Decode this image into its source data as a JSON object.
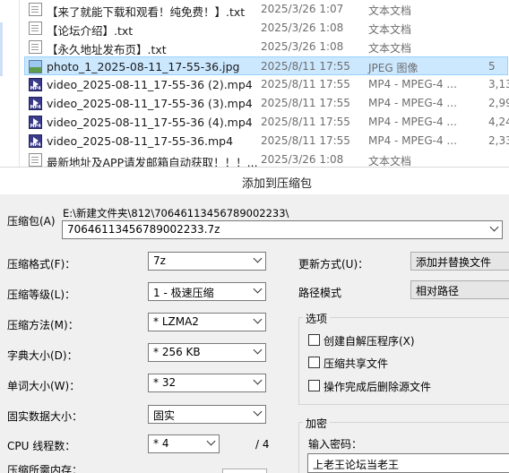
{
  "files": [
    {
      "name": "【来了就能下载和观看！纯免费！】.txt",
      "date": "2025/3/26 1:07",
      "type": "文本文档",
      "size": "",
      "icon": "text-file-icon"
    },
    {
      "name": "【论坛介绍】.txt",
      "date": "2025/3/26 1:08",
      "type": "文本文档",
      "size": "",
      "icon": "text-file-icon"
    },
    {
      "name": "【永久地址发布页】.txt",
      "date": "2025/3/26 1:08",
      "type": "文本文档",
      "size": "",
      "icon": "text-file-icon"
    },
    {
      "name": "photo_1_2025-08-11_17-55-36.jpg",
      "date": "2025/8/11 17:55",
      "type": "JPEG 图像",
      "size": "5",
      "icon": "image-file-icon",
      "selected": true
    },
    {
      "name": "video_2025-08-11_17-55-36 (2).mp4",
      "date": "2025/8/11 17:55",
      "type": "MP4 - MPEG-4 ...",
      "size": "3,13",
      "icon": "video-file-icon"
    },
    {
      "name": "video_2025-08-11_17-55-36 (3).mp4",
      "date": "2025/8/11 17:55",
      "type": "MP4 - MPEG-4 ...",
      "size": "2,99",
      "icon": "video-file-icon"
    },
    {
      "name": "video_2025-08-11_17-55-36 (4).mp4",
      "date": "2025/8/11 17:55",
      "type": "MP4 - MPEG-4 ...",
      "size": "4,24",
      "icon": "video-file-icon"
    },
    {
      "name": "video_2025-08-11_17-55-36.mp4",
      "date": "2025/8/11 17:55",
      "type": "MP4 - MPEG-4 ...",
      "size": "2,33",
      "icon": "video-file-icon"
    },
    {
      "name": "最新地址及APP请发邮箱自动获取！！！...",
      "date": "2025/3/26 1:08",
      "type": "文本文档",
      "size": "",
      "icon": "text-file-icon"
    }
  ],
  "dialog": {
    "title": "添加到压缩包",
    "archive_label": "压缩包(A)",
    "archive_path": "E:\\新建文件夹\\812\\70646113456789002233\\",
    "archive_name": "70646113456789002233.7z",
    "format_label": "压缩格式(F)：",
    "format_value": "7z",
    "level_label": "压缩等级(L)：",
    "level_value": "1 - 极速压缩",
    "method_label": "压缩方法(M)：",
    "method_value": "* LZMA2",
    "dict_label": "字典大小(D)：",
    "dict_value": "* 256 KB",
    "word_label": "单词大小(W)：",
    "word_value": "* 32",
    "solid_label": "固实数据大小：",
    "solid_value": "固实",
    "cpu_label": "CPU 线程数：",
    "cpu_value": "* 4",
    "cpu_total": "/ 4",
    "memory_label": "压缩所需内存：",
    "update_label": "更新方式(U)：",
    "update_value": "添加并替换文件",
    "path_label": "路径模式",
    "path_value": "相对路径",
    "options_title": "选项",
    "opt_sfx": "创建自解压程序(X)",
    "opt_shared": "压缩共享文件",
    "opt_delete": "操作完成后删除源文件",
    "encrypt_title": "加密",
    "password_label": "输入密码：",
    "password_value": "上老王论坛当老王"
  }
}
